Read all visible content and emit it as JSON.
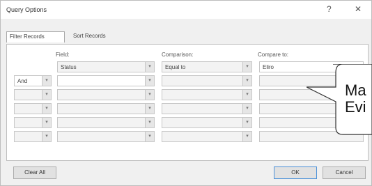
{
  "window": {
    "title": "Query Options",
    "help_glyph": "?",
    "close_glyph": "✕"
  },
  "tabs": [
    {
      "label": "Filter Records"
    },
    {
      "label": "Sort Records"
    }
  ],
  "grid": {
    "headers": {
      "field": "Field:",
      "comparison": "Comparison:",
      "compare_to": "Compare to:"
    },
    "rows": [
      {
        "logic": "",
        "field": "Status",
        "comparison": "Equal to",
        "compare_to": "Eliro"
      },
      {
        "logic": "And",
        "field": "",
        "comparison": "",
        "compare_to": ""
      },
      {
        "logic": "",
        "field": "",
        "comparison": "",
        "compare_to": ""
      },
      {
        "logic": "",
        "field": "",
        "comparison": "",
        "compare_to": ""
      },
      {
        "logic": "",
        "field": "",
        "comparison": "",
        "compare_to": ""
      },
      {
        "logic": "",
        "field": "",
        "comparison": "",
        "compare_to": ""
      }
    ]
  },
  "buttons": {
    "clear_all": "Clear All",
    "ok": "OK",
    "cancel": "Cancel"
  },
  "callout": {
    "line1": "Ma",
    "line2": "Evi"
  },
  "colors": {
    "accent": "#4a90d9"
  }
}
